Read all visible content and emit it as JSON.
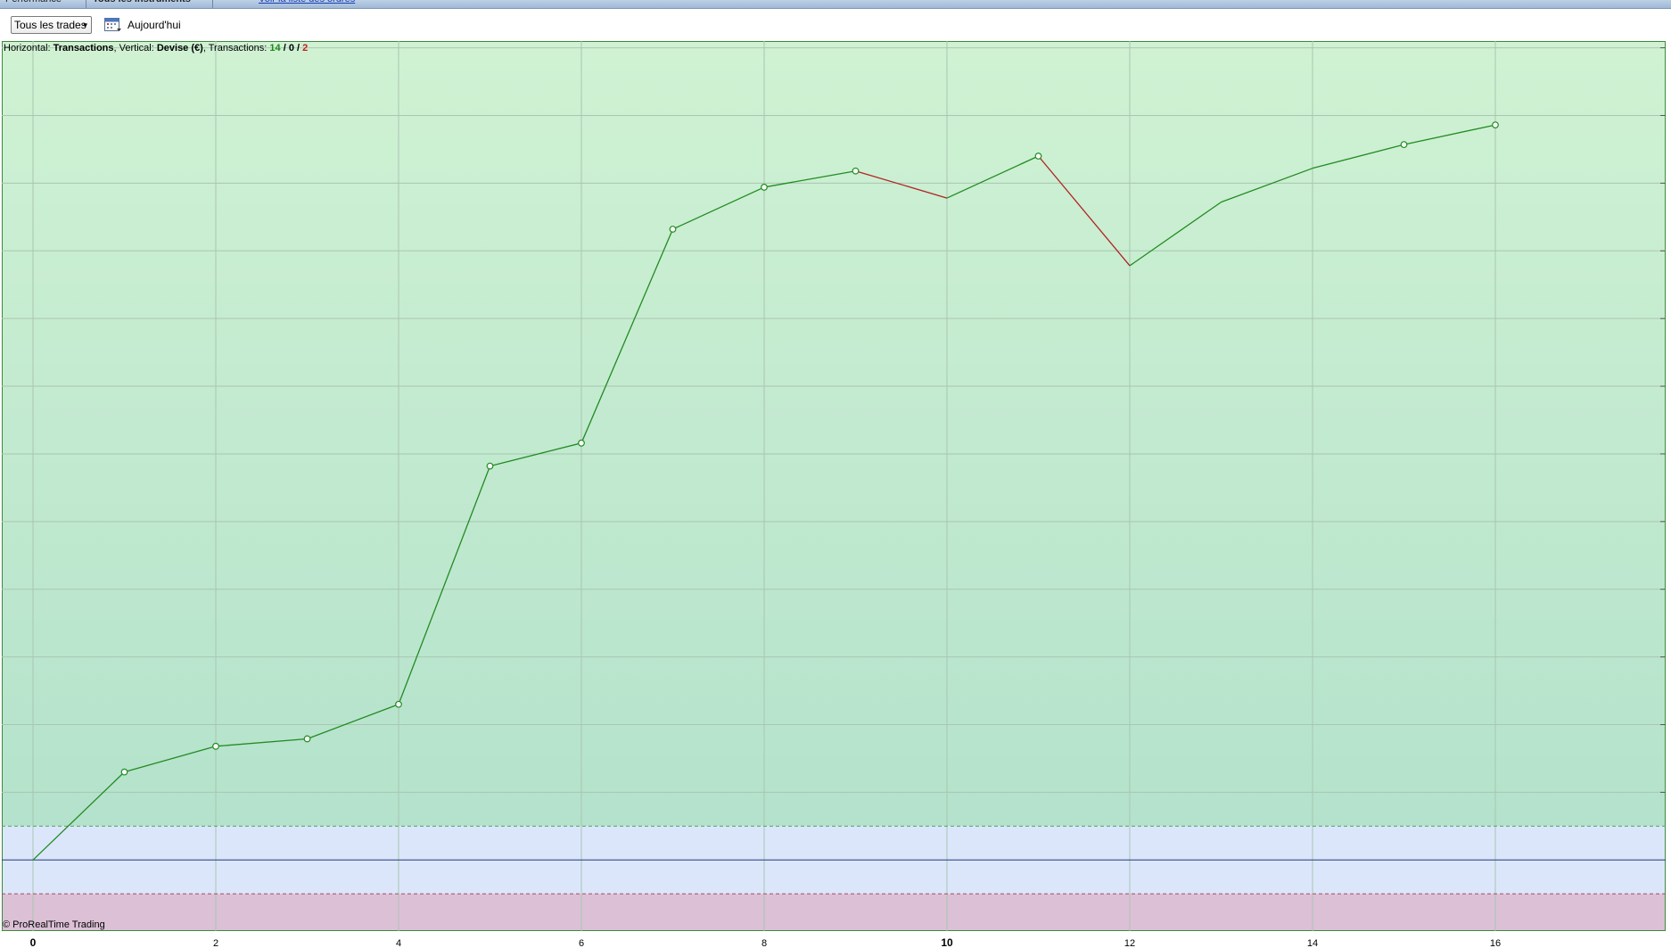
{
  "top_strip": {
    "tabs": [
      "Performance",
      "Tous les instruments"
    ],
    "link": "Voir la liste des ordres"
  },
  "toolbar": {
    "filter_value": "Tous les trades",
    "today_label": "Aujourd'hui"
  },
  "info": {
    "horizontal_label": "Horizontal:",
    "horizontal_value": "Transactions",
    "vertical_label": "Vertical:",
    "vertical_value": "Devise (€)",
    "transactions_label": "Transactions:",
    "wins": "14",
    "neutral": "0",
    "losses": "2"
  },
  "copyright": "© ProRealTime Trading",
  "colors": {
    "gain_line": "#228b22",
    "loss_line": "#b22222",
    "baseline": "#1f3a7a",
    "grid": "#a9c6b0"
  },
  "chart_data": {
    "type": "line",
    "xlabel": "Transactions",
    "ylabel": "Devise (€)",
    "x_ticks": [
      0,
      2,
      4,
      6,
      8,
      10,
      12,
      14,
      16
    ],
    "xlim": [
      0,
      17.6
    ],
    "ylim": [
      -1.05,
      12.1
    ],
    "legend": "none",
    "grid": true,
    "series": [
      {
        "x": [
          0,
          1,
          2,
          3,
          4,
          5,
          6,
          7,
          8,
          9,
          10,
          11,
          12,
          13,
          14,
          15,
          16
        ],
        "values": [
          0,
          1.3,
          1.68,
          1.79,
          2.3,
          5.82,
          6.16,
          9.32,
          9.94,
          10.18,
          9.78,
          10.4,
          8.78,
          9.72,
          10.22,
          10.57,
          10.86
        ]
      }
    ]
  }
}
